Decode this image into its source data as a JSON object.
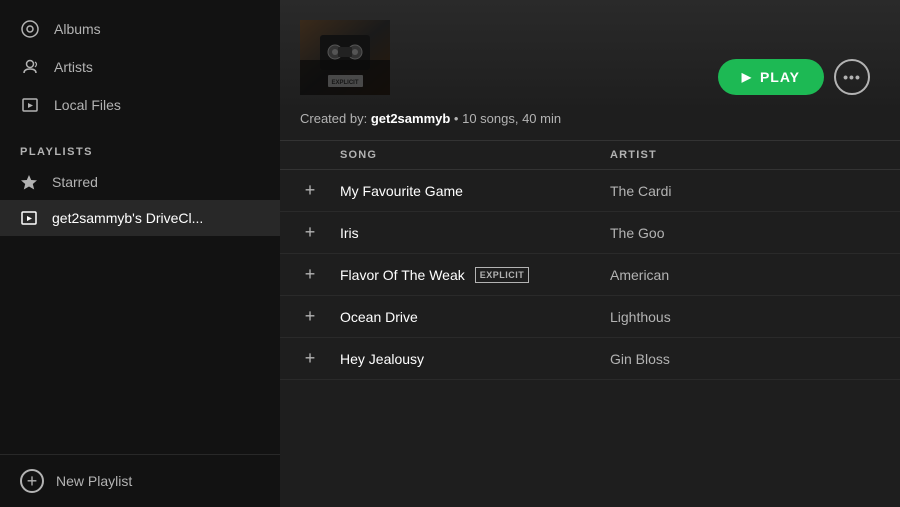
{
  "sidebar": {
    "nav_items": [
      {
        "label": "Albums",
        "icon": "album-icon"
      },
      {
        "label": "Artists",
        "icon": "artists-icon"
      },
      {
        "label": "Local Files",
        "icon": "local-files-icon"
      }
    ],
    "playlists_label": "PLAYLISTS",
    "playlists": [
      {
        "label": "Starred",
        "icon": "star-icon",
        "active": false
      },
      {
        "label": "get2sammyb's DriveCl...",
        "icon": "music-icon",
        "active": true
      }
    ],
    "new_playlist_label": "New Playlist"
  },
  "main": {
    "meta": {
      "created_by_prefix": "Created by: ",
      "creator": "get2sammyb",
      "dot": " • ",
      "songs_info": "10 songs, 40 min"
    },
    "play_button_label": "PLAY",
    "more_button_label": "...",
    "table_headers": {
      "song": "SONG",
      "artist": "ARTIST"
    },
    "songs": [
      {
        "title": "My Favourite Game",
        "artist": "The Cardi",
        "explicit": false
      },
      {
        "title": "Iris",
        "artist": "The Goo",
        "explicit": false
      },
      {
        "title": "Flavor Of The Weak",
        "artist": "American",
        "explicit": true
      },
      {
        "title": "Ocean Drive",
        "artist": "Lighthous",
        "explicit": false
      },
      {
        "title": "Hey Jealousy",
        "artist": "Gin Bloss",
        "explicit": false
      }
    ],
    "explicit_label": "EXPLICIT"
  }
}
